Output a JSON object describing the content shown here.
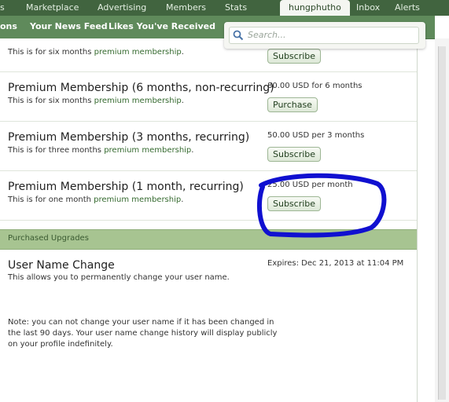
{
  "topnav": {
    "tabs": [
      {
        "label": "s"
      },
      {
        "label": "Marketplace"
      },
      {
        "label": "Advertising"
      },
      {
        "label": "Members"
      },
      {
        "label": "Stats"
      },
      {
        "label": "hungphutho"
      },
      {
        "label": "Inbox"
      },
      {
        "label": "Alerts"
      }
    ]
  },
  "subnav": {
    "links": [
      {
        "label": "ons"
      },
      {
        "label": "Your News Feed"
      },
      {
        "label": "Likes You've Received"
      }
    ]
  },
  "search": {
    "placeholder": "Search..."
  },
  "upgrades": [
    {
      "title": "",
      "desc_prefix": "This is for six months ",
      "desc_link": "premium membership",
      "desc_suffix": ".",
      "price": "",
      "button": "Subscribe"
    },
    {
      "title": "Premium Membership (6 months, non-recurring)",
      "desc_prefix": "This is for six months ",
      "desc_link": "premium membership",
      "desc_suffix": ".",
      "price": "80.00 USD for 6 months",
      "button": "Purchase"
    },
    {
      "title": "Premium Membership (3 months, recurring)",
      "desc_prefix": "This is for three months ",
      "desc_link": "premium membership",
      "desc_suffix": ".",
      "price": "50.00 USD per 3 months",
      "button": "Subscribe"
    },
    {
      "title": "Premium Membership (1 month, recurring)",
      "desc_prefix": "This is for one month ",
      "desc_link": "premium membership",
      "desc_suffix": ".",
      "price": "25.00 USD per month",
      "button": "Subscribe"
    }
  ],
  "purchased": {
    "section_label": "Purchased Upgrades",
    "title": "User Name Change",
    "desc": "This allows you to permanently change your user name.",
    "expires": "Expires: Dec 21, 2013 at 11:04 PM",
    "note": "Note: you can not change your user name if it has been changed in the last 90 days. Your user name change history will display publicly on your profile indefinitely."
  },
  "colors": {
    "nav": "#41643f",
    "subnav": "#5f8a5b",
    "section_bar": "#a7c491",
    "annotation": "#1010d0"
  },
  "icons": {
    "search": "search-icon"
  }
}
